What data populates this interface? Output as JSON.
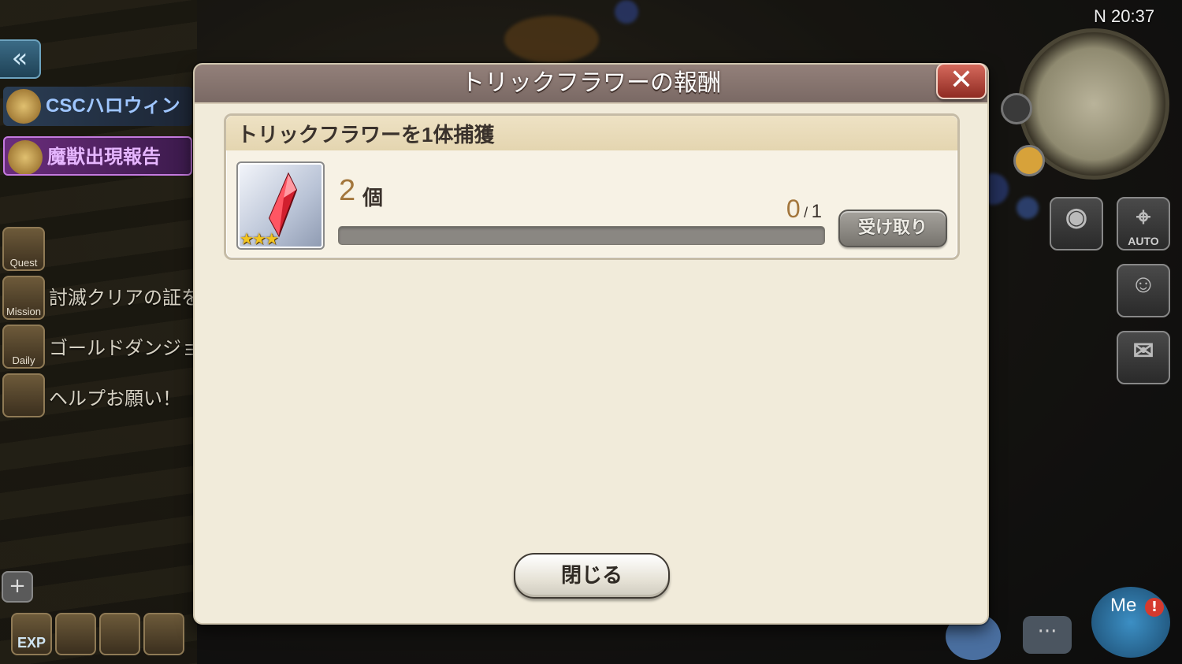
{
  "background": {
    "clock": "20:37",
    "compass_label": "N",
    "back_icon": "double-chevron-left",
    "event_banners": [
      {
        "label": "CSCハロウィン",
        "icon": "skull-badge-icon"
      },
      {
        "label": "魔獣出現報告",
        "icon": "beast-icon"
      }
    ],
    "side_menu": [
      {
        "button": "Quest",
        "icon": "quest-chest-icon",
        "text": ""
      },
      {
        "button": "Mission",
        "icon": "mission-feather-icon",
        "text": "討滅クリアの証を"
      },
      {
        "button": "Daily",
        "icon": "daily-scroll-icon",
        "text": "ゴールドダンジョ"
      },
      {
        "button": "",
        "icon": "handshake-icon",
        "text": "ヘルプお願い！"
      }
    ],
    "bottom_left_buttons": [
      {
        "label": "EXP",
        "icon": "exp-up-icon"
      },
      {
        "label": "",
        "icon": "gold-up-icon"
      },
      {
        "label": "",
        "icon": "boot-up-icon"
      },
      {
        "label": "",
        "icon": "basket-up-icon"
      }
    ],
    "right_buttons": [
      {
        "label": "",
        "icon": "camera-icon"
      },
      {
        "label": "AUTO",
        "icon": "auto-target-icon"
      },
      {
        "label": "",
        "icon": "party-icon"
      },
      {
        "label": "",
        "icon": "guild-mail-icon"
      }
    ],
    "me_label": "Me",
    "me_badge": "!"
  },
  "modal": {
    "title": "トリックフラワーの報酬",
    "close_icon": "close-x-icon",
    "quest": {
      "description": "トリックフラワーを1体捕獲",
      "reward_icon": "red-crystal-icon",
      "reward_rarity": "★★★",
      "reward_count": "2",
      "reward_unit": "個",
      "progress_current": "0",
      "progress_separator": "/",
      "progress_total": "1",
      "progress_fraction": 0,
      "claim_label": "受け取り"
    },
    "close_button_label": "閉じる"
  },
  "colors": {
    "header": "#847370",
    "panel": "#f1ebda",
    "accent_number": "#a3763c",
    "close_x": "#b84a3e"
  }
}
